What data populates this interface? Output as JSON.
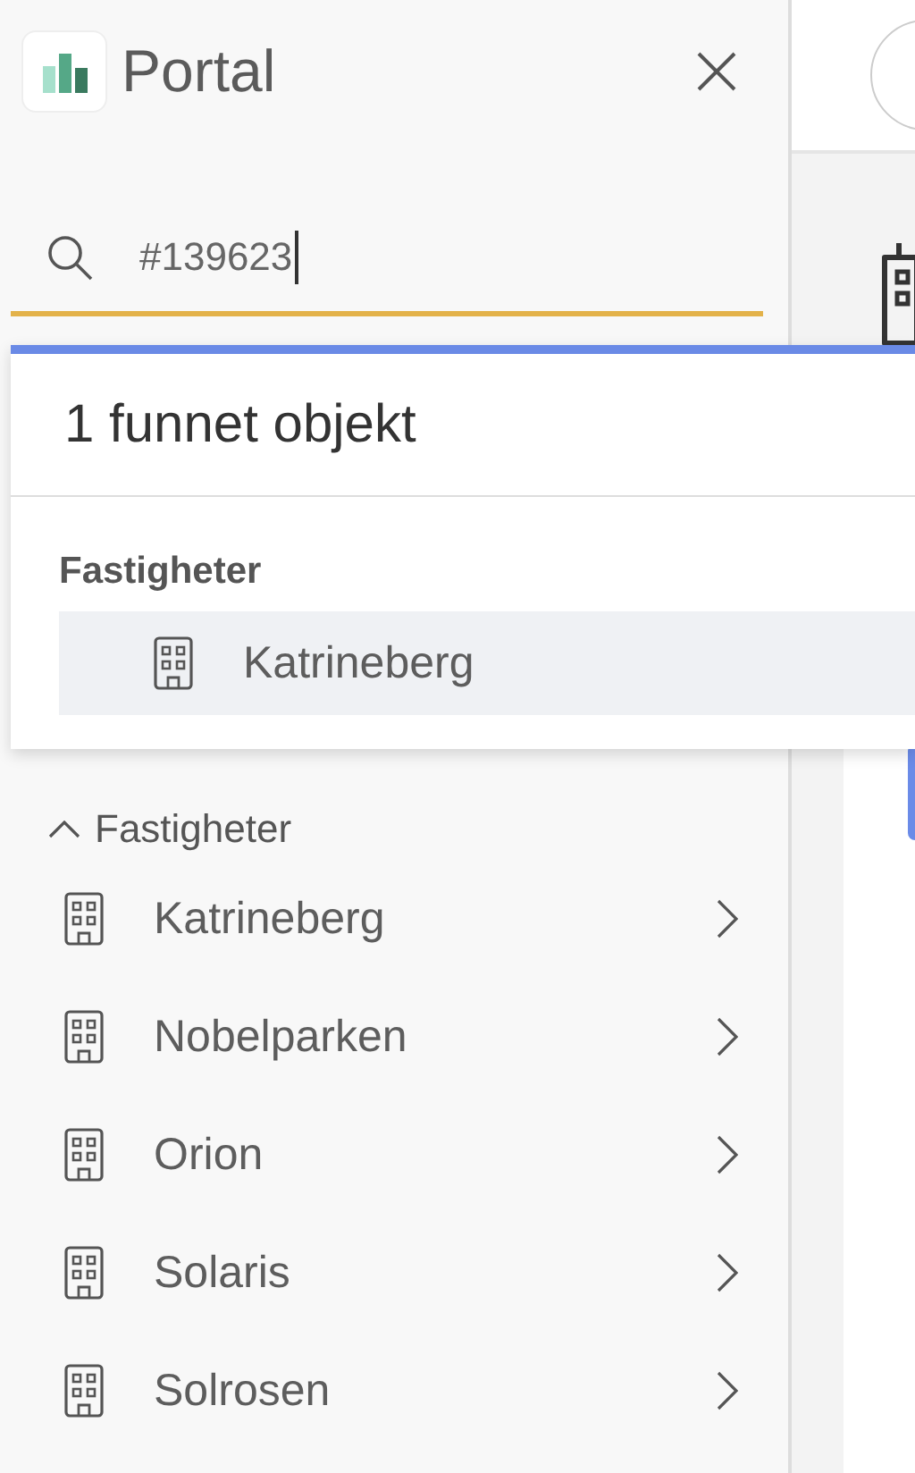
{
  "app": {
    "title": "Portal"
  },
  "search": {
    "value": "#139623",
    "focused": true
  },
  "results": {
    "heading": "1 funnet objekt",
    "groups": [
      {
        "label": "Fastigheter",
        "items": [
          {
            "label": "Katrineberg",
            "selected": true
          }
        ]
      }
    ]
  },
  "tree": {
    "label": "Fastigheter",
    "expanded": true,
    "items": [
      {
        "label": "Katrineberg"
      },
      {
        "label": "Nobelparken"
      },
      {
        "label": "Orion"
      },
      {
        "label": "Solaris"
      },
      {
        "label": "Solrosen"
      }
    ]
  }
}
